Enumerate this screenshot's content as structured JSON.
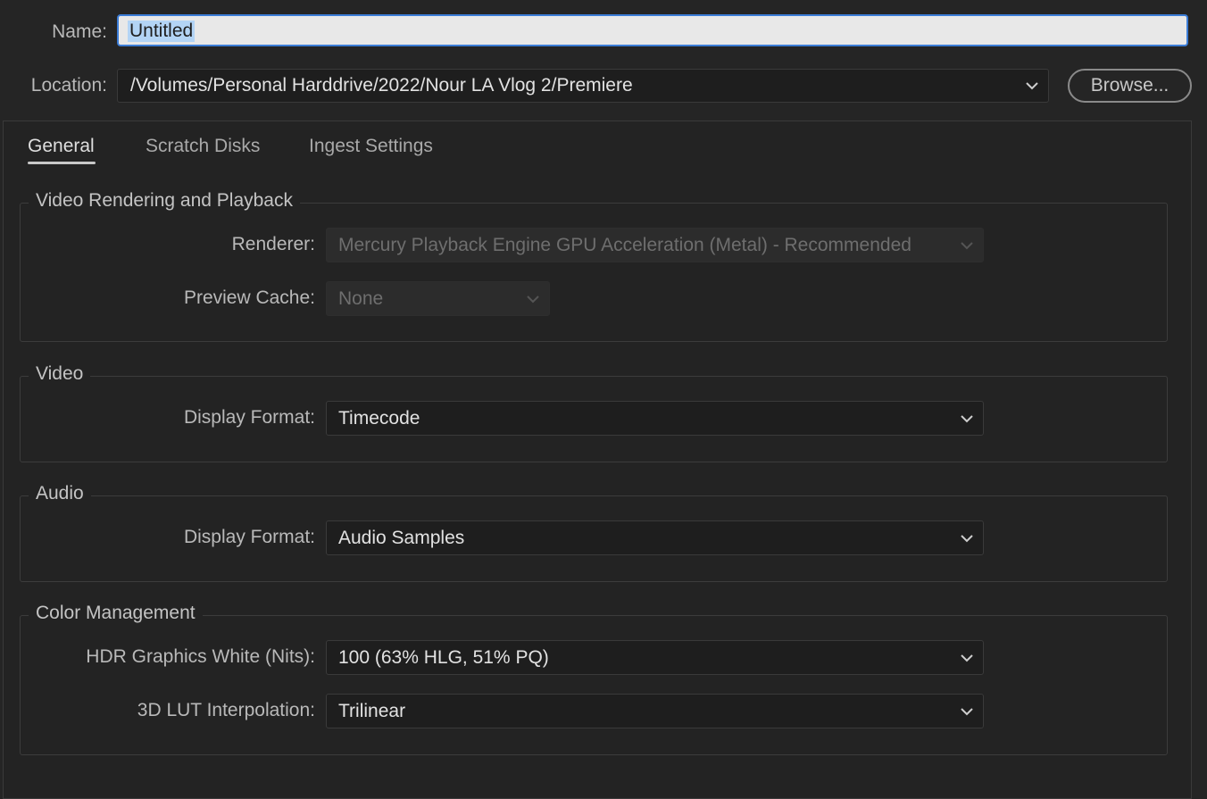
{
  "name_row": {
    "label": "Name:",
    "value": "Untitled"
  },
  "location_row": {
    "label": "Location:",
    "value": "/Volumes/Personal Harddrive/2022/Nour LA Vlog 2/Premiere",
    "browse_label": "Browse..."
  },
  "tabs": [
    {
      "label": "General",
      "active": true
    },
    {
      "label": "Scratch Disks",
      "active": false
    },
    {
      "label": "Ingest Settings",
      "active": false
    }
  ],
  "sections": {
    "video_rendering": {
      "title": "Video Rendering and Playback",
      "renderer_label": "Renderer:",
      "renderer_value": "Mercury Playback Engine GPU Acceleration (Metal) - Recommended",
      "preview_cache_label": "Preview Cache:",
      "preview_cache_value": "None"
    },
    "video": {
      "title": "Video",
      "display_format_label": "Display Format:",
      "display_format_value": "Timecode"
    },
    "audio": {
      "title": "Audio",
      "display_format_label": "Display Format:",
      "display_format_value": "Audio Samples"
    },
    "color_management": {
      "title": "Color Management",
      "hdr_label": "HDR Graphics White (Nits):",
      "hdr_value": "100 (63% HLG, 51% PQ)",
      "lut_label": "3D LUT Interpolation:",
      "lut_value": "Trilinear"
    }
  },
  "colors": {
    "background": "#252525",
    "focus_border": "#3b7cd6",
    "selection": "#b3d4f5"
  },
  "icons": {
    "dropdown": "chevron-down-icon"
  }
}
